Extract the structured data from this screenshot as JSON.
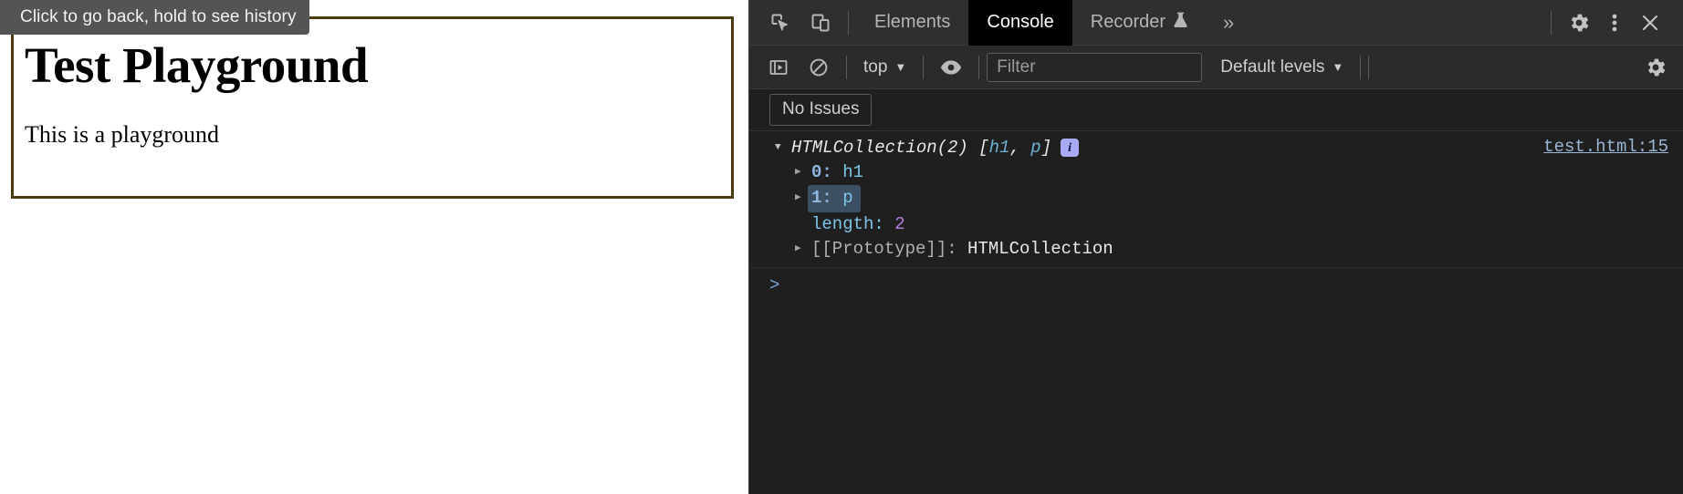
{
  "page": {
    "tooltip": "Click to go back, hold to see history",
    "heading": "Test Playground",
    "paragraph": "This is a playground",
    "border_color": "#4a3c10",
    "background": "#ffffff"
  },
  "devtools": {
    "theme_background": "#1f1f1f",
    "accent": "#a8aaf5",
    "tabbar": {
      "inspect_icon": "inspect-cursor-icon",
      "device_toggle_icon": "device-toolbar-icon",
      "tabs": [
        {
          "label": "Elements",
          "active": false
        },
        {
          "label": "Console",
          "active": true
        },
        {
          "label": "Recorder",
          "active": false,
          "badge_icon": "experiment-flask-icon"
        }
      ],
      "overflow_label": "»",
      "settings_icon": "gear-icon",
      "more_icon": "kebab-menu-icon",
      "close_icon": "close-icon"
    },
    "console_toolbar": {
      "sidebar_toggle_icon": "console-sidebar-icon",
      "clear_icon": "clear-console-icon",
      "context_label": "top",
      "context_caret": "▼",
      "eye_icon": "live-expression-eye-icon",
      "filter_placeholder": "Filter",
      "filter_value": "",
      "levels_label": "Default levels",
      "levels_caret": "▼",
      "settings_icon": "gear-icon"
    },
    "issues_bar": {
      "no_issues_label": "No Issues"
    },
    "console": {
      "messages": [
        {
          "expanded": true,
          "title_prefix": "HTMLCollection(2)",
          "title_items": "[h1, p]",
          "item_a": "h1",
          "item_b": "p",
          "info_badge": "i",
          "source_link": "test.html:15",
          "properties": [
            {
              "expandable": true,
              "key": "0",
              "separator": ":",
              "value": "h1",
              "key_type": "index",
              "value_type": "tag",
              "selected": false
            },
            {
              "expandable": true,
              "key": "1",
              "separator": ":",
              "value": "p",
              "key_type": "index",
              "value_type": "tag",
              "selected": true
            },
            {
              "expandable": false,
              "key": "length",
              "separator": ":",
              "value": "2",
              "key_type": "name",
              "value_type": "number",
              "selected": false
            },
            {
              "expandable": true,
              "key": "[[Prototype]]",
              "separator": ":",
              "value": "HTMLCollection",
              "key_type": "proto",
              "value_type": "proto",
              "selected": false
            }
          ]
        }
      ],
      "prompt_chevron": ">",
      "prompt_value": ""
    }
  }
}
